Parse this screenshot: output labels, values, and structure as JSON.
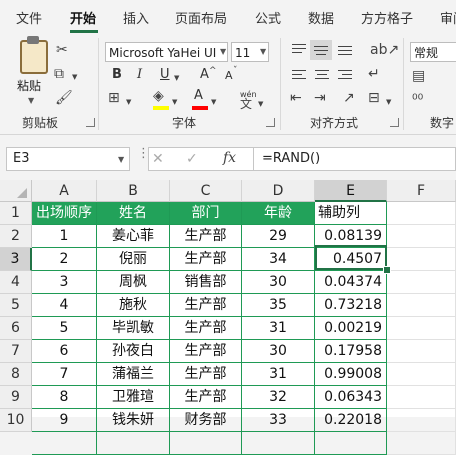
{
  "ribbon_tabs": [
    "文件",
    "开始",
    "插入",
    "页面布局",
    "公式",
    "数据",
    "方方格子",
    "审阅"
  ],
  "active_tab": "开始",
  "clipboard": {
    "paste_label": "粘贴",
    "group_label": "剪贴板"
  },
  "font": {
    "name": "Microsoft YaHei UI",
    "size": "11",
    "bold": "B",
    "italic": "I",
    "underline": "U",
    "grow": "A",
    "shrink": "A",
    "wen": "wén",
    "group_label": "字体"
  },
  "alignment": {
    "group_label": "对齐方式"
  },
  "number": {
    "format": "常规",
    "group_label": "数字"
  },
  "colors": {
    "accent": "#217346",
    "table_header": "#22a25a",
    "table_border": "#1f9a55",
    "highlight_yellow": "#ffff00",
    "font_red": "#ff0000"
  },
  "name_box": "E3",
  "formula": "=RAND()",
  "fx": "fx",
  "columns": [
    "A",
    "B",
    "C",
    "D",
    "E",
    "F"
  ],
  "rows": [
    "1",
    "2",
    "3",
    "4",
    "5",
    "6",
    "7",
    "8",
    "9",
    "10"
  ],
  "selected_cell": {
    "col": "E",
    "row": "3"
  },
  "table": {
    "headers": [
      "出场顺序",
      "姓名",
      "部门",
      "年龄",
      "辅助列"
    ],
    "data": [
      [
        "1",
        "姜心菲",
        "生产部",
        "29",
        "0.08139"
      ],
      [
        "2",
        "倪丽",
        "生产部",
        "34",
        "0.4507"
      ],
      [
        "3",
        "周枫",
        "销售部",
        "30",
        "0.04374"
      ],
      [
        "4",
        "施秋",
        "生产部",
        "35",
        "0.73218"
      ],
      [
        "5",
        "毕凯敏",
        "生产部",
        "31",
        "0.00219"
      ],
      [
        "6",
        "孙夜白",
        "生产部",
        "30",
        "0.17958"
      ],
      [
        "7",
        "蒲福兰",
        "生产部",
        "31",
        "0.99008"
      ],
      [
        "8",
        "卫雅瑄",
        "生产部",
        "32",
        "0.06343"
      ],
      [
        "9",
        "钱朱妍",
        "财务部",
        "33",
        "0.22018"
      ]
    ]
  }
}
